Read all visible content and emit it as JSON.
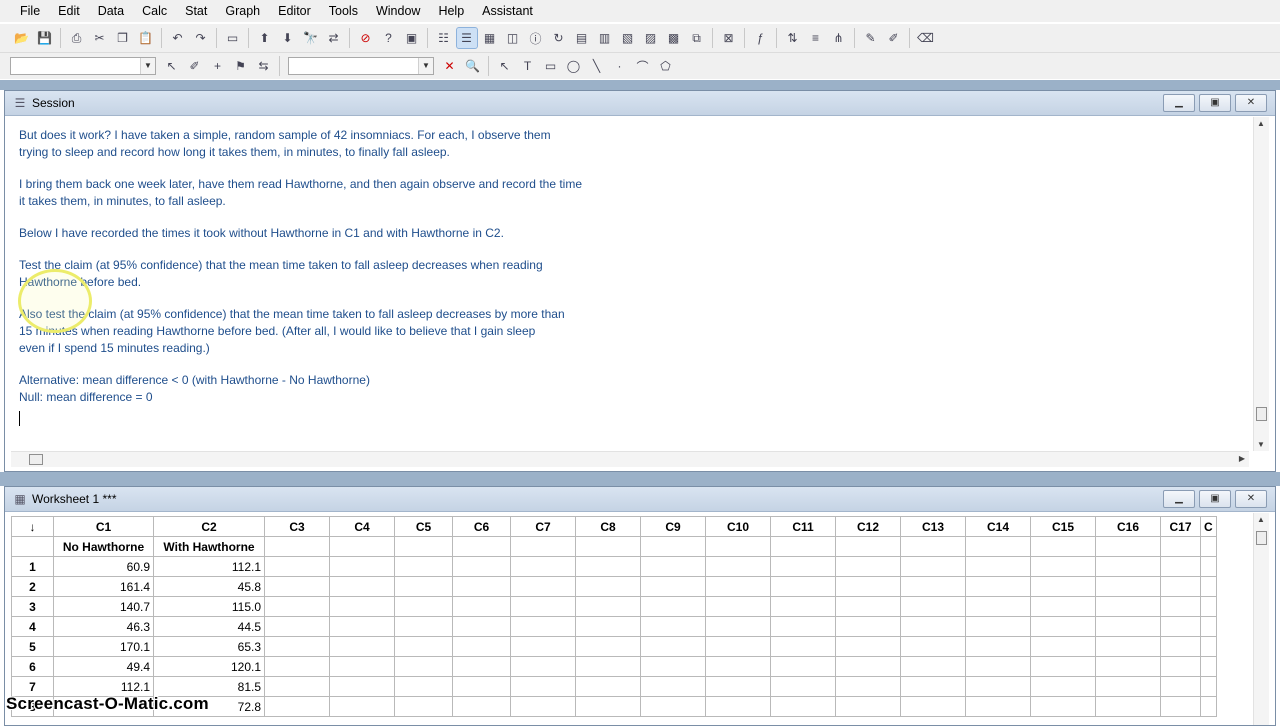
{
  "menu": [
    "File",
    "Edit",
    "Data",
    "Calc",
    "Stat",
    "Graph",
    "Editor",
    "Tools",
    "Window",
    "Help",
    "Assistant"
  ],
  "toolbar1_icons": [
    "open-icon",
    "save-icon",
    "print-icon",
    "cut-icon",
    "copy-icon",
    "paste-icon",
    "undo-icon",
    "redo-icon",
    "insert-cells-icon",
    "prev-brushed-icon",
    "next-brushed-icon",
    "find-icon",
    "replace-icon",
    "cancel-icon",
    "help-icon",
    "stop-icon",
    "project-manager-icon",
    "show-session-icon",
    "show-worksheets-icon",
    "show-graphs-icon",
    "show-info-icon",
    "show-history-icon",
    "related-documents-icon",
    "report-pad-icon",
    "graph-folder-icon",
    "session-folder-icon",
    "worksheet-folder-icon",
    "tile-icon",
    "close-all-graphs-icon",
    "formula-icon",
    "sort-icon",
    "stack-icon",
    "tree-icon",
    "pen-icon",
    "brush-icon",
    "eraser-icon"
  ],
  "toolbar2_icons": [
    "select-icon",
    "brush-tool-icon",
    "crosshair-icon",
    "flag-icon",
    "swap-icon",
    "delete-icon",
    "zoom-icon",
    "arrow-icon",
    "text-icon",
    "rectangle-icon",
    "ellipse-icon",
    "line-icon",
    "dot-icon",
    "polyline-icon",
    "polygon-icon"
  ],
  "session": {
    "title": "Session",
    "paragraphs": [
      "But does it work? I have taken a simple, random sample of 42 insomniacs. For each, I observe them\ntrying to sleep and record how long it takes them, in minutes, to finally fall asleep.",
      "I bring them back one week later, have them read Hawthorne, and then again observe and record the time\nit takes them, in minutes, to fall asleep.",
      "Below I have recorded the times it took without Hawthorne in C1 and with Hawthorne in C2.",
      "Test the claim (at 95% confidence) that the mean time taken to fall asleep decreases when reading\nHawthorne before bed.",
      "Also test the claim (at 95% confidence) that the mean time taken to fall asleep decreases by more than\n15 minutes when reading Hawthorne before bed. (After all, I would like to believe that I gain sleep\neven if I spend 15 minutes reading.)",
      "Alternative: mean difference < 0 (with Hawthorne - No Hawthorne)\nNull: mean difference = 0"
    ]
  },
  "worksheet": {
    "title": "Worksheet 1 ***",
    "corner": "↓",
    "columns": [
      "C1",
      "C2",
      "C3",
      "C4",
      "C5",
      "C6",
      "C7",
      "C8",
      "C9",
      "C10",
      "C11",
      "C12",
      "C13",
      "C14",
      "C15",
      "C16",
      "C17",
      "C"
    ],
    "names": [
      "No Hawthorne",
      "With Hawthorne"
    ],
    "rows": [
      {
        "n": "1",
        "c1": "60.9",
        "c2": "112.1"
      },
      {
        "n": "2",
        "c1": "161.4",
        "c2": "45.8"
      },
      {
        "n": "3",
        "c1": "140.7",
        "c2": "115.0"
      },
      {
        "n": "4",
        "c1": "46.3",
        "c2": "44.5"
      },
      {
        "n": "5",
        "c1": "170.1",
        "c2": "65.3"
      },
      {
        "n": "6",
        "c1": "49.4",
        "c2": "120.1"
      },
      {
        "n": "7",
        "c1": "112.1",
        "c2": "81.5"
      },
      {
        "n": "8",
        "c1": "",
        "c2": "72.8"
      }
    ]
  },
  "watermark": "Screencast-O-Matic.com"
}
